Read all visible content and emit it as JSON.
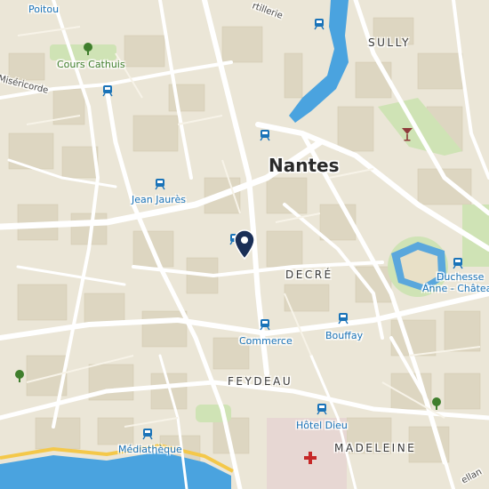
{
  "map": {
    "city": "Nantes",
    "districts": [
      "SULLY",
      "DECRÉ",
      "FEYDEAU",
      "MADELEINE"
    ],
    "transit_stops": {
      "jean_jaures": "Jean Jaurès",
      "duchesse": "Duchesse\nAnne - Château",
      "commerce": "Commerce",
      "bouffay": "Bouffay",
      "hotel_dieu": "Hôtel Dieu",
      "mediatheque": "Médiathèque"
    },
    "parks": {
      "cours_cathuis": "Cours Cathuis"
    },
    "streets": {
      "poitou": "Poitou",
      "misericorde": "Miséricorde",
      "artillerie": "rtillerie",
      "bottom_right": "ellan"
    },
    "colors": {
      "land": "#ebe6d7",
      "block": "#ddd6c1",
      "road": "#ffffff",
      "water": "#4aa3df",
      "park": "#cfe3b5",
      "transit": "#1a73b8",
      "pin": "#1a2f57",
      "hospital": "#c62828",
      "bar": "#8e3a3a"
    }
  }
}
